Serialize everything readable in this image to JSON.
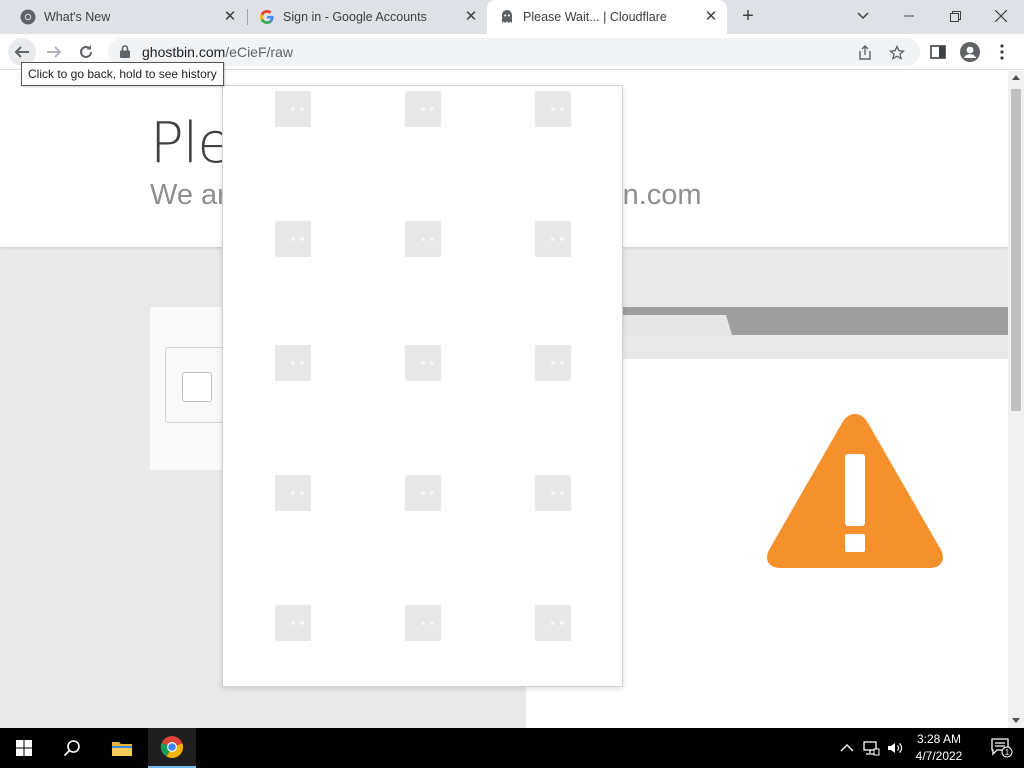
{
  "browser": {
    "tabs": [
      {
        "title": "What's New",
        "icon": "chrome-icon"
      },
      {
        "title": "Sign in - Google Accounts",
        "icon": "google-g-icon"
      },
      {
        "title": "Please Wait... | Cloudflare",
        "icon": "ghost-icon",
        "active": true
      }
    ],
    "close_glyph": "✕",
    "new_tab_glyph": "+"
  },
  "toolbar": {
    "url_host": "ghostbin.com",
    "url_path": "/eCieF/raw"
  },
  "tooltip": {
    "text": "Click to go back, hold to see history"
  },
  "page": {
    "heading": "Ple",
    "subheading_left": "We ar",
    "subheading_right": "bin.com",
    "warning_color": "#f4912c"
  },
  "popup": {
    "rows": 5,
    "cols": 3,
    "tile_state": "loading"
  },
  "taskbar": {
    "clock_time": "3:28 AM",
    "clock_date": "4/7/2022",
    "notification_count": "1"
  }
}
